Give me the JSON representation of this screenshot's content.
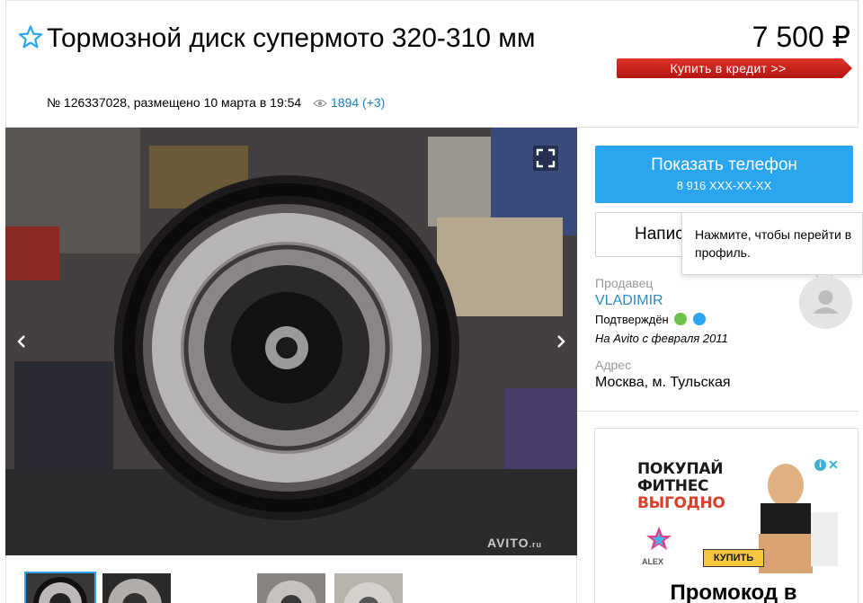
{
  "listing": {
    "title": "Тормозной диск супермото 320-310 мм",
    "meta": "№ 126337028, размещено 10 марта в 19:54",
    "views": "1894 (+3)",
    "price": "7 500 ₽",
    "credit_label": "Купить в кредит >>"
  },
  "gallery": {
    "watermark": "AVITO",
    "watermark_suffix": ".ru",
    "thumbnail_count": 4,
    "active_thumbnail": 1
  },
  "contact": {
    "phone_label": "Показать телефон",
    "phone_masked": "8 916 XXX-XX-XX",
    "write_label": "Написать",
    "tooltip": "Нажмите, чтобы перейти в профиль."
  },
  "seller": {
    "label": "Продавец",
    "name": "VLADIMIR",
    "verified": "Подтверждён",
    "since": "На Avito с февраля 2011"
  },
  "address": {
    "label": "Адрес",
    "value": "Москва, м. Тульская"
  },
  "ad": {
    "line1": "ПОКУПАЙ",
    "line2": "ФИТНЕС",
    "line3": "ВЫГОДНО",
    "brand": "ALEX",
    "button": "КУПИТЬ",
    "info": "i",
    "close": "✕",
    "promo": "Промокод в"
  },
  "colors": {
    "link": "#2e8ac6",
    "phone_button": "#2ba5f0",
    "credit_button": "#c8201b",
    "ad_accent": "#d9402a"
  }
}
